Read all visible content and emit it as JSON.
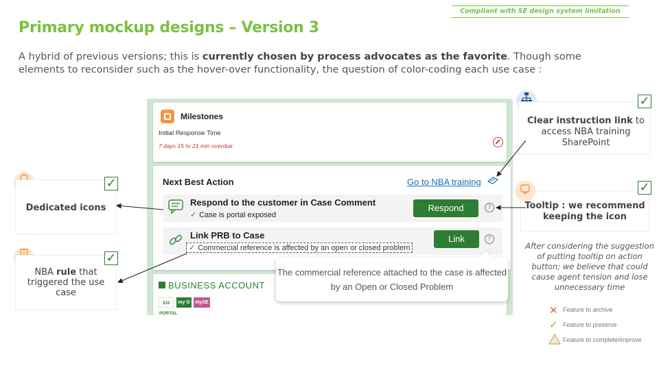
{
  "header": {
    "compliance_tag": "Compliant with SE design system limitation",
    "title": "Primary mockup designs – Version 3",
    "intro_pre": "A hybrid of previous versions; this is ",
    "intro_bold": "currently chosen by process advocates as the favorite",
    "intro_post": ". Though some elements to reconsider such as the hover-over functionality, the question of color-coding each use case :"
  },
  "milestones": {
    "title": "Milestones",
    "subtitle": "Initial Response Time",
    "overdue": "7 days 15 hr 21 min overdue",
    "icon": "milestone-icon"
  },
  "nba": {
    "title": "Next Best Action",
    "training_link": "Go to NBA training",
    "rows": [
      {
        "title": "Respond to the customer in Case Comment",
        "sub": "Case is portal exposed",
        "button": "Respond",
        "icon": "comment-icon"
      },
      {
        "title": "Link PRB to Case",
        "sub": "Commercial reference is affected by an open or closed problem",
        "button": "Link",
        "icon": "link-icon"
      }
    ],
    "help_glyph": "?",
    "check_glyph": "✓"
  },
  "tooltip": {
    "text": "The commercial reference attached to the case is affected by an Open or Closed Problem"
  },
  "business_account": {
    "title": "BUSINESS ACCOUNT",
    "logos": [
      "333 PORTAL",
      "my O",
      "mySE"
    ]
  },
  "annotations": {
    "instruction_bold": "Clear instruction link",
    "instruction_rest": " to access NBA training SharePoint",
    "dedicated_icons": "Dedicated icons",
    "tooltip_bold": "Tooltip : we recommend keeping the icon",
    "nba_pre": "NBA ",
    "nba_bold": "rule",
    "nba_post": " that triggered the use case",
    "note": "After considering the suggestion of  putting tooltip on action button; we believe that could cause agent tension and lose unnecessary time"
  },
  "legend": {
    "archive": "Feature to archive",
    "preserve": "Feature to preserve",
    "improve": "Feature to complete/improve"
  },
  "colors": {
    "accent": "#7ac143",
    "button": "#2e7d32",
    "link": "#1a6fb4",
    "overdue": "#c23934"
  }
}
